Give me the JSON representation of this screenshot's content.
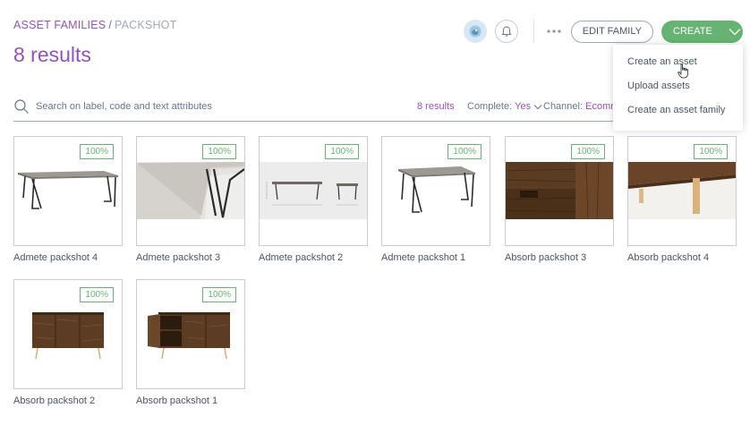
{
  "breadcrumb": {
    "root": "Asset families",
    "separator": "/",
    "current": "Packshot"
  },
  "title": "8 results",
  "header": {
    "edit_family": "Edit family",
    "create": "Create"
  },
  "create_menu": {
    "items": [
      "Create an asset",
      "Upload assets",
      "Create an asset family"
    ]
  },
  "search": {
    "placeholder": "Search on label, code and text attributes",
    "result_count": "8 results",
    "complete_label": "Complete:",
    "complete_value": "Yes",
    "channel_label": "Channel:",
    "channel_value": "Ecomme"
  },
  "assets": [
    {
      "label": "Admete packshot 4",
      "completeness": "100%",
      "image": "table-dark-legs"
    },
    {
      "label": "Admete packshot 3",
      "completeness": "100%",
      "image": "table-closeup"
    },
    {
      "label": "Admete packshot 2",
      "completeness": "100%",
      "image": "table-dimensions"
    },
    {
      "label": "Admete packshot 1",
      "completeness": "100%",
      "image": "table-dark-legs"
    },
    {
      "label": "Absorb packshot 3",
      "completeness": "100%",
      "image": "wood-drawer-closeup"
    },
    {
      "label": "Absorb packshot 4",
      "completeness": "100%",
      "image": "wood-leg-closeup"
    },
    {
      "label": "Absorb packshot 2",
      "completeness": "100%",
      "image": "sideboard-closed"
    },
    {
      "label": "Absorb packshot 1",
      "completeness": "100%",
      "image": "sideboard-open"
    }
  ],
  "colors": {
    "accent": "#9452ba",
    "success": "#67b373",
    "text": "#67768a"
  }
}
